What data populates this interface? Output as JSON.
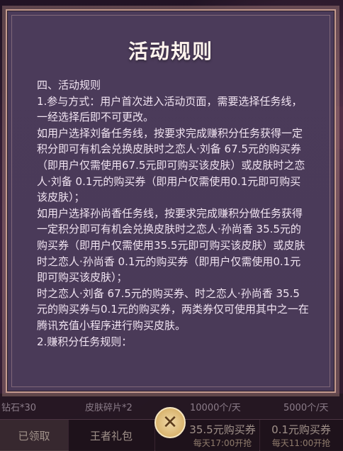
{
  "modal": {
    "title": "活动规则",
    "paragraphs": [
      "四、活动规则",
      "1.参与方式：用户首次进入活动页面，需要选择任务线，一经选择后即不可更改。",
      "如用户选择刘备任务线，按要求完成赚积分任务获得一定积分即可有机会兑换皮肤时之恋人·刘备 67.5元的购买券（即用户仅需使用67.5元即可购买该皮肤）或皮肤时之恋人·刘备 0.1元的购买券（即用户仅需使用0.1元即可购买该皮肤）；",
      "如用户选择孙尚香任务线，按要求完成赚积分做任务获得一定积分即可有机会兑换皮肤时之恋人·孙尚香 35.5元的购买券（即用户仅需使用35.5元即可购买该皮肤）或皮肤时之恋人·孙尚香 0.1元的购买券（即用户仅需使用0.1元即可购买该皮肤）；",
      "时之恋人·刘备 67.5元的购买券、时之恋人·孙尚香 35.5元的购买券与0.1元的购买券，两类券仅可使用其中之一在腾讯充值小程序进行购买皮肤。",
      "2.赚积分任务规则："
    ]
  },
  "background": {
    "row": {
      "diamond": "钻石*30",
      "fragments": "皮肤碎片*2",
      "quota1": "10000个/天",
      "quota2": "5000个/天"
    },
    "bar": {
      "claimed": "已领取",
      "gift": "王者礼包",
      "coupon1_line1": "35.5元购买券",
      "coupon1_line2": "每天17:00开抢",
      "coupon2_line1": "0.1元购买券",
      "coupon2_line2": "每天11:00开抢"
    }
  },
  "close_icon": "close-x-icon"
}
